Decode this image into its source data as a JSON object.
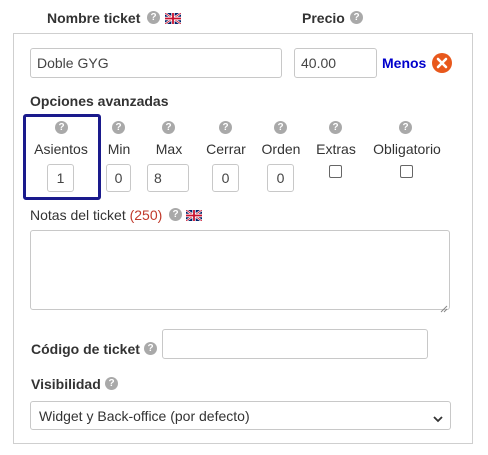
{
  "header": {
    "ticket_name_label": "Nombre ticket",
    "price_label": "Precio"
  },
  "ticket": {
    "name_value": "Doble GYG",
    "price_value": "40.00",
    "less_link": "Menos"
  },
  "advanced": {
    "title": "Opciones avanzadas",
    "columns": [
      {
        "label": "Asientos",
        "value": "1"
      },
      {
        "label": "Min",
        "value": "0"
      },
      {
        "label": "Max",
        "value": "8"
      },
      {
        "label": "Cerrar",
        "value": "0"
      },
      {
        "label": "Orden",
        "value": "0"
      },
      {
        "label": "Extras"
      },
      {
        "label": "Obligatorio"
      }
    ],
    "help_glyph": "?"
  },
  "notes": {
    "label": "Notas del ticket",
    "count": "(250)",
    "value": ""
  },
  "code": {
    "label": "Código de ticket",
    "value": ""
  },
  "visibility": {
    "label": "Visibilidad",
    "selected": "Widget y Back-office (por defecto)"
  },
  "colors": {
    "accent_link": "#0000cc",
    "remove_icon": "#e8581c",
    "highlight_border": "#1a1a8c",
    "counter": "#c0392b"
  },
  "icons": [
    "help-icon",
    "uk-flag-icon",
    "remove-icon",
    "chevron-down-icon"
  ]
}
